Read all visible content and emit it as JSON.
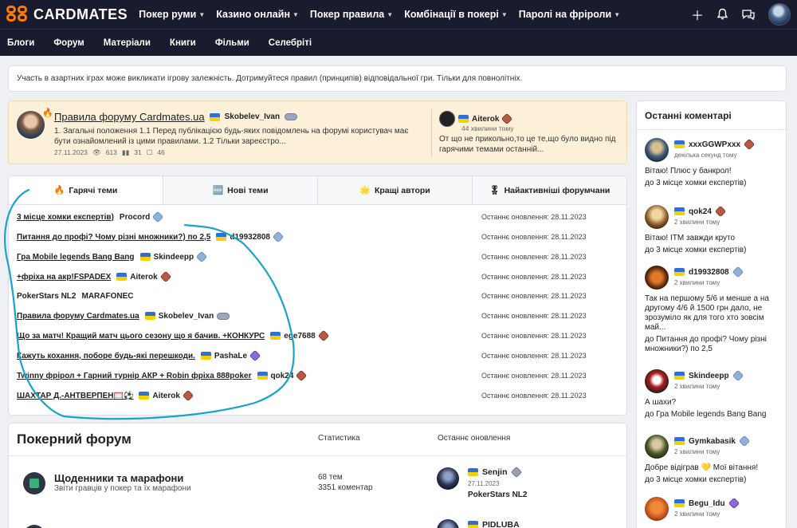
{
  "brand": "CARDMATES",
  "topnav": [
    "Покер руми",
    "Казино онлайн",
    "Покер правила",
    "Комбінації в покері",
    "Паролі на фріроли"
  ],
  "subnav": [
    "Блоги",
    "Форум",
    "Матеріали",
    "Книги",
    "Фільми",
    "Селебріті"
  ],
  "notice": "Участь в азартних іграх може викликати ігрову залежність. Дотримуйтеся правил (принципів) відповідальної гри. Тільки для повнолітніх.",
  "pinned": {
    "title": "Правила форуму Cardmates.ua",
    "author": "Skobelev_Ivan",
    "excerpt": "1. Загальні положення 1.1 Перед публікацією будь-яких повідомлень на форумі користувач має бути ознайомлений із цими правилами. 1.2 Тільки зареєстро...",
    "date": "27.11.2023",
    "views": "613",
    "likes": "31",
    "comments": "46",
    "last_author": "Aiterok",
    "last_time": "44 хвилини тому",
    "last_text": "От що не прикольно,то це те,що було видно під гарячими темами останній..."
  },
  "tabs": [
    {
      "label": "Гарячі теми",
      "icon": "🔥"
    },
    {
      "label": "Нові теми",
      "icon": "🆕"
    },
    {
      "label": "Кращі автори",
      "icon": "🌟"
    },
    {
      "label": "Найактивніші форумчани",
      "icon": "🎖"
    }
  ],
  "update_prefix": "Останнє оновлення:",
  "topics": [
    {
      "title": "3 місце хомки експертів)",
      "author": "Procord",
      "flag": false,
      "badge": "blue",
      "date": "28.11.2023"
    },
    {
      "title": "Питання до профі? Чому різні множники?) по 2,5",
      "author": "d19932808",
      "flag": true,
      "badge": "blue",
      "date": "28.11.2023"
    },
    {
      "title": "Гра Mobile legends Bang Bang",
      "author": "Skindeepp",
      "flag": true,
      "badge": "blue",
      "date": "28.11.2023"
    },
    {
      "title": "+фріха на акр!FSPADEX",
      "author": "Aiterok",
      "flag": true,
      "badge": "red",
      "date": "28.11.2023"
    },
    {
      "title": "PokerStars NL2",
      "author": "MARAFONEC",
      "flag": false,
      "badge": "",
      "date": "28.11.2023",
      "plain": true
    },
    {
      "title": "Правила форуму Cardmates.ua",
      "author": "Skobelev_Ivan",
      "flag": true,
      "badge": "wing",
      "date": "28.11.2023"
    },
    {
      "title": "Що за матч! Кращий матч цього сезону що я бачив. +КОНКУРС",
      "author": "ege7688",
      "flag": true,
      "badge": "red",
      "date": "28.11.2023"
    },
    {
      "title": "Кажуть кохання, поборе будь-які перешкоди.",
      "author": "PashaLe",
      "flag": true,
      "badge": "purple",
      "date": "28.11.2023"
    },
    {
      "title": "Twinny фрірол + Гарний турнір АКР + Robin фріха 888poker",
      "author": "qok24",
      "flag": true,
      "badge": "red",
      "date": "28.11.2023"
    },
    {
      "title": "ШАХТАР Д.-АНТВЕРПЕН🥅⚽",
      "author": "Aiterok",
      "flag": true,
      "badge": "red",
      "date": "28.11.2023"
    }
  ],
  "forum": {
    "title": "Покерний форум",
    "col_stats": "Статистика",
    "col_last": "Останнє оновлення",
    "rows": [
      {
        "name": "Щоденники та марафони",
        "desc": "Звіти гравців у покер та їх марафони",
        "topics": "68 тем",
        "comments": "3351 коментар",
        "last_author": "Senjin",
        "last_date": "27.11.2023",
        "last_topic": "PokerStars NL2"
      },
      {
        "name": "",
        "desc": "",
        "topics": "",
        "comments": "",
        "last_author": "PIDLUBA",
        "last_date": "",
        "last_topic": ""
      }
    ]
  },
  "sidebar": {
    "title": "Останні коментарі",
    "comments": [
      {
        "author": "xxxGGWPxxx",
        "badge": "red",
        "time": "декілька секунд тому",
        "text": "Вітаю! Плюс у банкрол!",
        "topic": "до 3 місце хомки експертів)"
      },
      {
        "author": "qok24",
        "badge": "red",
        "time": "2 хвилини тому",
        "text": "Вітаю! ITM завжди круто",
        "topic": "до 3 місце хомки експертів)"
      },
      {
        "author": "d19932808",
        "badge": "blue",
        "time": "2 хвилини тому",
        "text": "Так на першому 5/6 и менше а на другому 4/6 й 1500 грн дало, не зрозуміло як для того хто зовсім май...",
        "topic": "до Питання до профі? Чому різні множники?) по 2,5"
      },
      {
        "author": "Skindeepp",
        "badge": "blue",
        "time": "2 хвилини тому",
        "text": "А шахи?",
        "topic": "до Гра Mobile legends Bang Bang"
      },
      {
        "author": "Gymkabasik",
        "badge": "blue",
        "time": "2 хвилини тому",
        "text": "Добре відіграв 💛 Мої вітання!",
        "topic": "до 3 місце хомки експертів)"
      },
      {
        "author": "Begu_Idu",
        "badge": "purple",
        "time": "2 хвилини тому",
        "text": "",
        "topic": ""
      }
    ]
  },
  "colors": {
    "header": "#191b2e",
    "accent": "#ff7a00",
    "annotation": "#18a3c9",
    "pinned_bg": "#fcf1d8"
  }
}
